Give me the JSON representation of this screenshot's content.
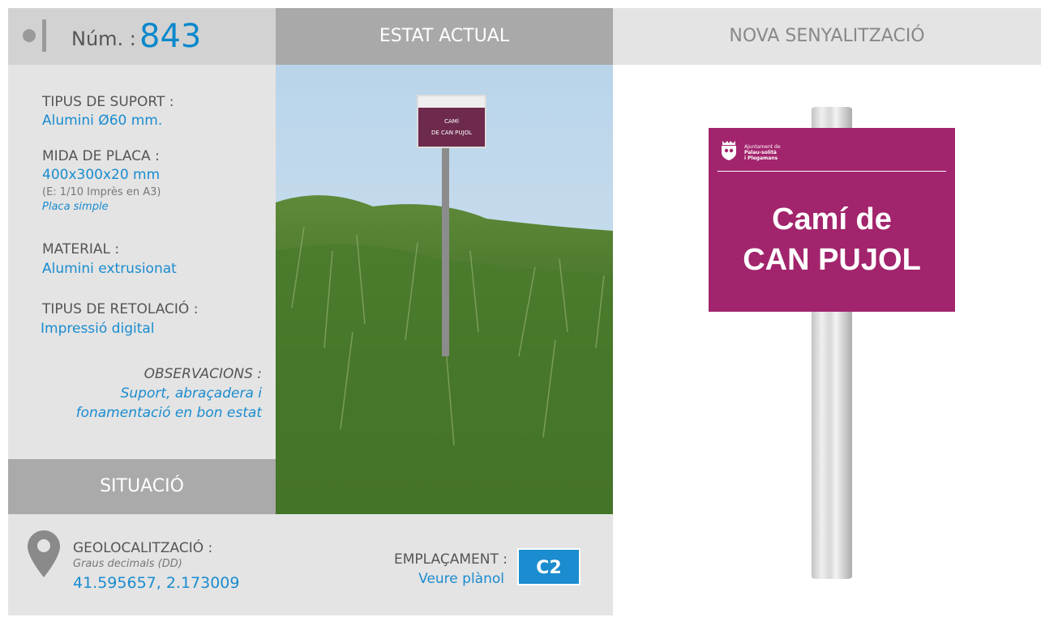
{
  "header": {
    "num_label": "Núm. :",
    "num_value": "843",
    "current_state": "ESTAT ACTUAL",
    "new_signage": "NOVA SENYALITZACIÓ"
  },
  "specs": {
    "support_type_label": "TIPUS DE SUPORT :",
    "support_type_value": "Alumini Ø60 mm.",
    "plate_size_label": "MIDA DE PLACA :",
    "plate_size_value": "400x300x20 mm",
    "plate_size_scale": "(E: 1/10 Imprès en A3)",
    "plate_kind": "Placa simple",
    "material_label": "MATERIAL :",
    "material_value": "Alumini extrusionat",
    "lettering_label": "TIPUS DE RETOLACIÓ :",
    "lettering_value": "Impressió digital",
    "observations_label": "OBSERVACIONS :",
    "observations_line1": "Suport, abraçadera i",
    "observations_line2": "fonamentació en bon estat"
  },
  "situation": {
    "label": "SITUACIÓ",
    "geo_label": "GEOLOCALITZACIÓ :",
    "geo_format": "Graus decimals (DD)",
    "geo_value": "41.595657, 2.173009",
    "placement_label": "EMPLAÇAMENT :",
    "placement_link": "Veure plànol",
    "placement_code": "C2"
  },
  "photo": {
    "sign_line1": "CAMÍ",
    "sign_line2": "DE CAN PUJOL"
  },
  "new_sign": {
    "org_line1": "Ajuntament de",
    "org_line2": "Palau-solità",
    "org_line3": "i Plegamans",
    "title_line1": "Camí de",
    "title_line2": "CAN PUJOL"
  },
  "colors": {
    "accent_blue": "#1a8ccf",
    "plate_magenta": "#a2246c",
    "panel_gray": "#e4e4e4"
  }
}
